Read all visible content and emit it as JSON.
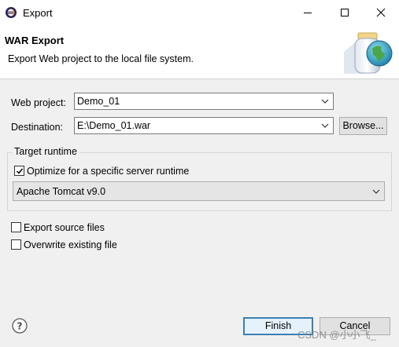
{
  "window": {
    "title": "Export",
    "icon": "eclipse-icon"
  },
  "header": {
    "title": "WAR Export",
    "description": "Export Web project to the local file system.",
    "banner_icon": "jar-globe-icon"
  },
  "form": {
    "web_project_label": "Web project:",
    "web_project_value": "Demo_01",
    "destination_label": "Destination:",
    "destination_value": "E:\\Demo_01.war",
    "browse_label": "Browse..."
  },
  "target_runtime": {
    "legend": "Target runtime",
    "optimize_label": "Optimize for a specific server runtime",
    "optimize_checked": true,
    "runtime_value": "Apache Tomcat v9.0"
  },
  "options": {
    "export_source_label": "Export source files",
    "export_source_checked": false,
    "overwrite_label": "Overwrite existing file",
    "overwrite_checked": false
  },
  "footer": {
    "finish_label": "Finish",
    "cancel_label": "Cancel",
    "help_icon": "help-icon"
  },
  "watermark": "CSDN @小小飞_"
}
